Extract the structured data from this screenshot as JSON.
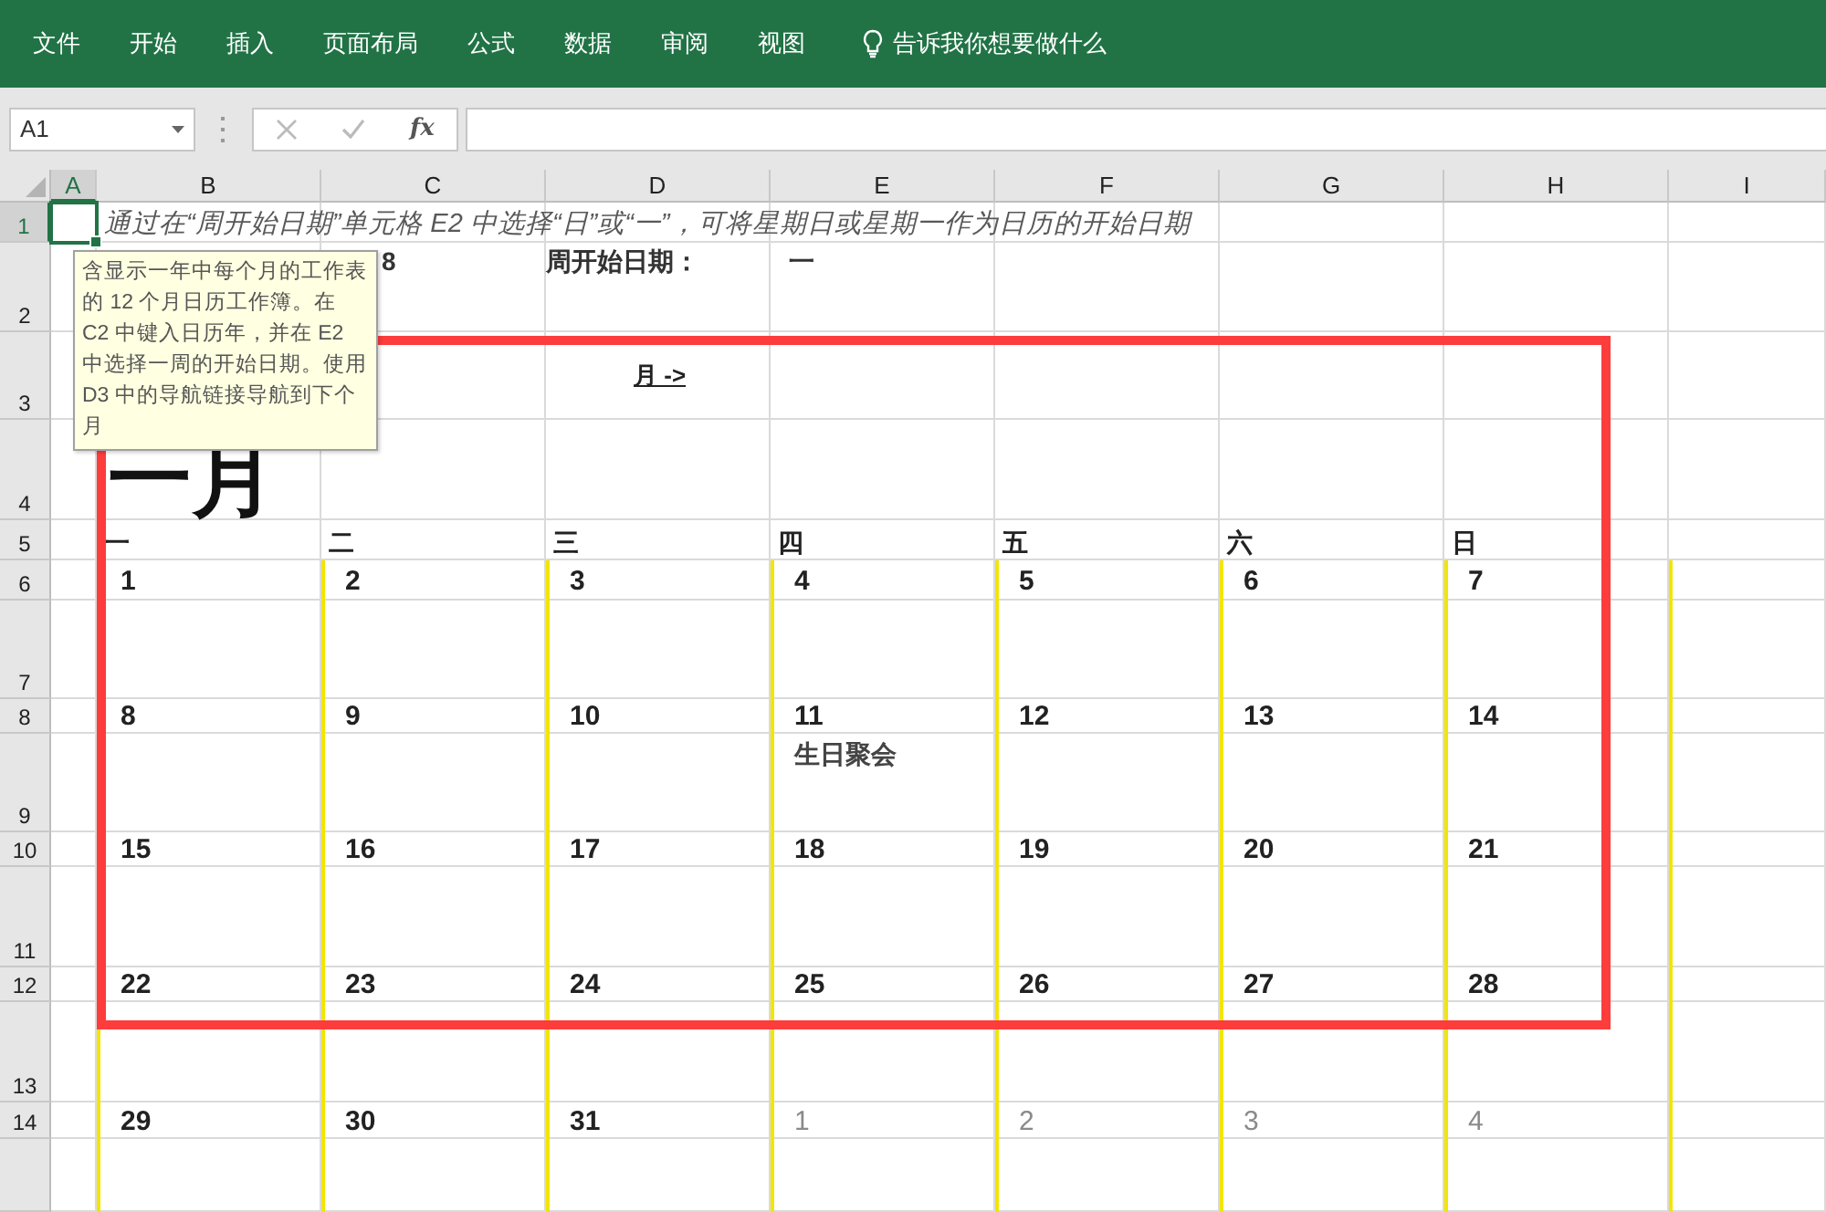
{
  "menu": [
    {
      "label": "文件"
    },
    {
      "label": "开始"
    },
    {
      "label": "插入"
    },
    {
      "label": "页面布局"
    },
    {
      "label": "公式"
    },
    {
      "label": "数据"
    },
    {
      "label": "审阅"
    },
    {
      "label": "视图"
    }
  ],
  "tell_me": "告诉我你想要做什么",
  "formula_bar": {
    "name_box": "A1",
    "function_label": "fx"
  },
  "sheet": {
    "columns": [
      {
        "label": "A",
        "selected": true
      },
      {
        "label": "B",
        "selected": false
      },
      {
        "label": "C",
        "selected": false
      },
      {
        "label": "D",
        "selected": false
      },
      {
        "label": "E",
        "selected": false
      },
      {
        "label": "F",
        "selected": false
      },
      {
        "label": "G",
        "selected": false
      },
      {
        "label": "H",
        "selected": false
      },
      {
        "label": "I",
        "selected": false
      }
    ],
    "rows": [
      {
        "label": "1",
        "selected": true
      },
      {
        "label": "2",
        "selected": false
      },
      {
        "label": "3",
        "selected": false
      },
      {
        "label": "4",
        "selected": false
      },
      {
        "label": "5",
        "selected": false
      },
      {
        "label": "6",
        "selected": false
      },
      {
        "label": "7",
        "selected": false
      },
      {
        "label": "8",
        "selected": false
      },
      {
        "label": "9",
        "selected": false
      },
      {
        "label": "10",
        "selected": false
      },
      {
        "label": "11",
        "selected": false
      },
      {
        "label": "12",
        "selected": false
      },
      {
        "label": "13",
        "selected": false
      },
      {
        "label": "14",
        "selected": false
      }
    ],
    "instruction": "通过在“周开始日期”单元格 E2 中选择“日”或“一”，可将星期日或星期一作为日历的开始日期",
    "year_fragment": "8",
    "week_start_label": "周开始日期：",
    "week_start_value": "一",
    "next_link": "月 ->",
    "month_title": "一月",
    "weekdays": [
      "一",
      "二",
      "三",
      "四",
      "五",
      "六",
      "日"
    ],
    "weeks": [
      [
        {
          "day": "1",
          "muted": false
        },
        {
          "day": "2",
          "muted": false
        },
        {
          "day": "3",
          "muted": false
        },
        {
          "day": "4",
          "muted": false
        },
        {
          "day": "5",
          "muted": false
        },
        {
          "day": "6",
          "muted": false
        },
        {
          "day": "7",
          "muted": false
        }
      ],
      [
        {
          "day": "8",
          "muted": false
        },
        {
          "day": "9",
          "muted": false
        },
        {
          "day": "10",
          "muted": false
        },
        {
          "day": "11",
          "muted": false,
          "event": "生日聚会"
        },
        {
          "day": "12",
          "muted": false
        },
        {
          "day": "13",
          "muted": false
        },
        {
          "day": "14",
          "muted": false
        }
      ],
      [
        {
          "day": "15",
          "muted": false
        },
        {
          "day": "16",
          "muted": false
        },
        {
          "day": "17",
          "muted": false
        },
        {
          "day": "18",
          "muted": false
        },
        {
          "day": "19",
          "muted": false
        },
        {
          "day": "20",
          "muted": false
        },
        {
          "day": "21",
          "muted": false
        }
      ],
      [
        {
          "day": "22",
          "muted": false
        },
        {
          "day": "23",
          "muted": false
        },
        {
          "day": "24",
          "muted": false
        },
        {
          "day": "25",
          "muted": false
        },
        {
          "day": "26",
          "muted": false
        },
        {
          "day": "27",
          "muted": false
        },
        {
          "day": "28",
          "muted": false
        }
      ],
      [
        {
          "day": "29",
          "muted": false
        },
        {
          "day": "30",
          "muted": false
        },
        {
          "day": "31",
          "muted": false
        },
        {
          "day": "1",
          "muted": true
        },
        {
          "day": "2",
          "muted": true
        },
        {
          "day": "3",
          "muted": true
        },
        {
          "day": "4",
          "muted": true
        }
      ]
    ],
    "comment": "含显示一年中每个月的工作表的 12 个月日历工作簿。在 C2 中键入日历年，并在 E2 中选择一周的开始日期。使用 D3 中的导航链接导航到下个月"
  }
}
